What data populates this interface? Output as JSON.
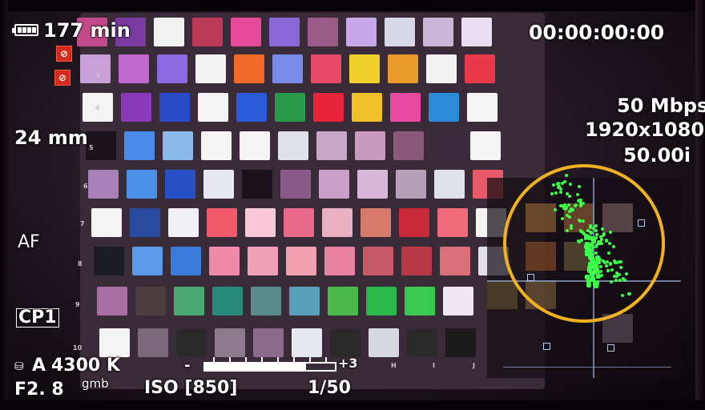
{
  "osd": {
    "battery_time": "177 min",
    "timecode": "00:00:00:00",
    "bitrate": "50 Mbps",
    "resolution": "1920x1080",
    "framerate": "50.00i",
    "focal_length": "24 mm",
    "focus_mode": "AF",
    "custom_picture": "CP1",
    "white_balance_mode": "A",
    "color_temp": "4300 K",
    "aperture": "F2. 8",
    "gain_tag": "gmb",
    "iso": "ISO [850]",
    "shutter": "1/50",
    "exposure_minus": "-",
    "exposure_plus": "+3",
    "exposure_level": 0.78,
    "audio_mute_icon": "mic-off-icon",
    "hdmi_off_icon": "speaker-off-icon"
  },
  "chart": {
    "row_numbers": [
      "3",
      "4",
      "5",
      "6",
      "7",
      "8",
      "9",
      "10"
    ],
    "column_letters": [
      "H",
      "I",
      "J"
    ]
  },
  "overlay": {
    "highlight_color": "#f2b21e",
    "vectorscope_color": "#3cff4a"
  }
}
